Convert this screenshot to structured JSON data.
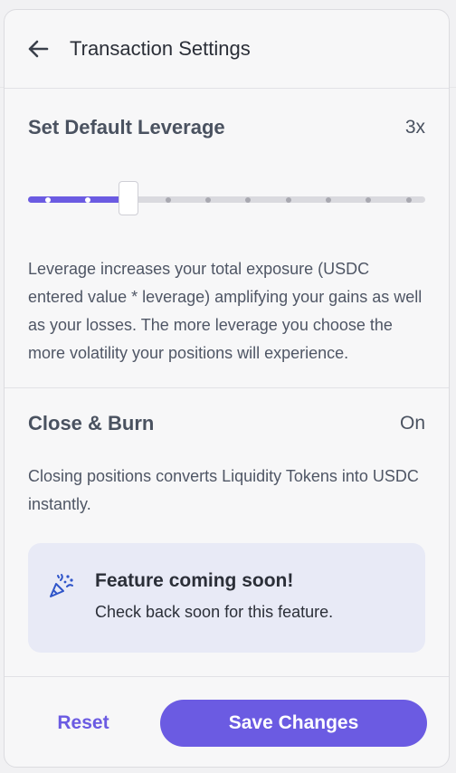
{
  "header": {
    "title": "Transaction Settings"
  },
  "leverage": {
    "label": "Set Default Leverage",
    "value": "3x",
    "slider_level": 3,
    "slider_max": 10,
    "description": "Leverage increases your total exposure (USDC entered value * leverage) amplifying your gains as well as your losses. The more leverage you choose the more volatility your positions will experience."
  },
  "close_burn": {
    "label": "Close & Burn",
    "value": "On",
    "description": "Closing positions converts Liquidity Tokens into USDC instantly."
  },
  "notice": {
    "icon": "confetti-icon",
    "title": "Feature coming soon!",
    "subtitle": "Check back soon for this feature."
  },
  "footer": {
    "reset_label": "Reset",
    "save_label": "Save Changes"
  },
  "colors": {
    "accent": "#6b5be2",
    "notice_bg": "#e8eaf6",
    "icon_blue": "#2f55c9"
  }
}
